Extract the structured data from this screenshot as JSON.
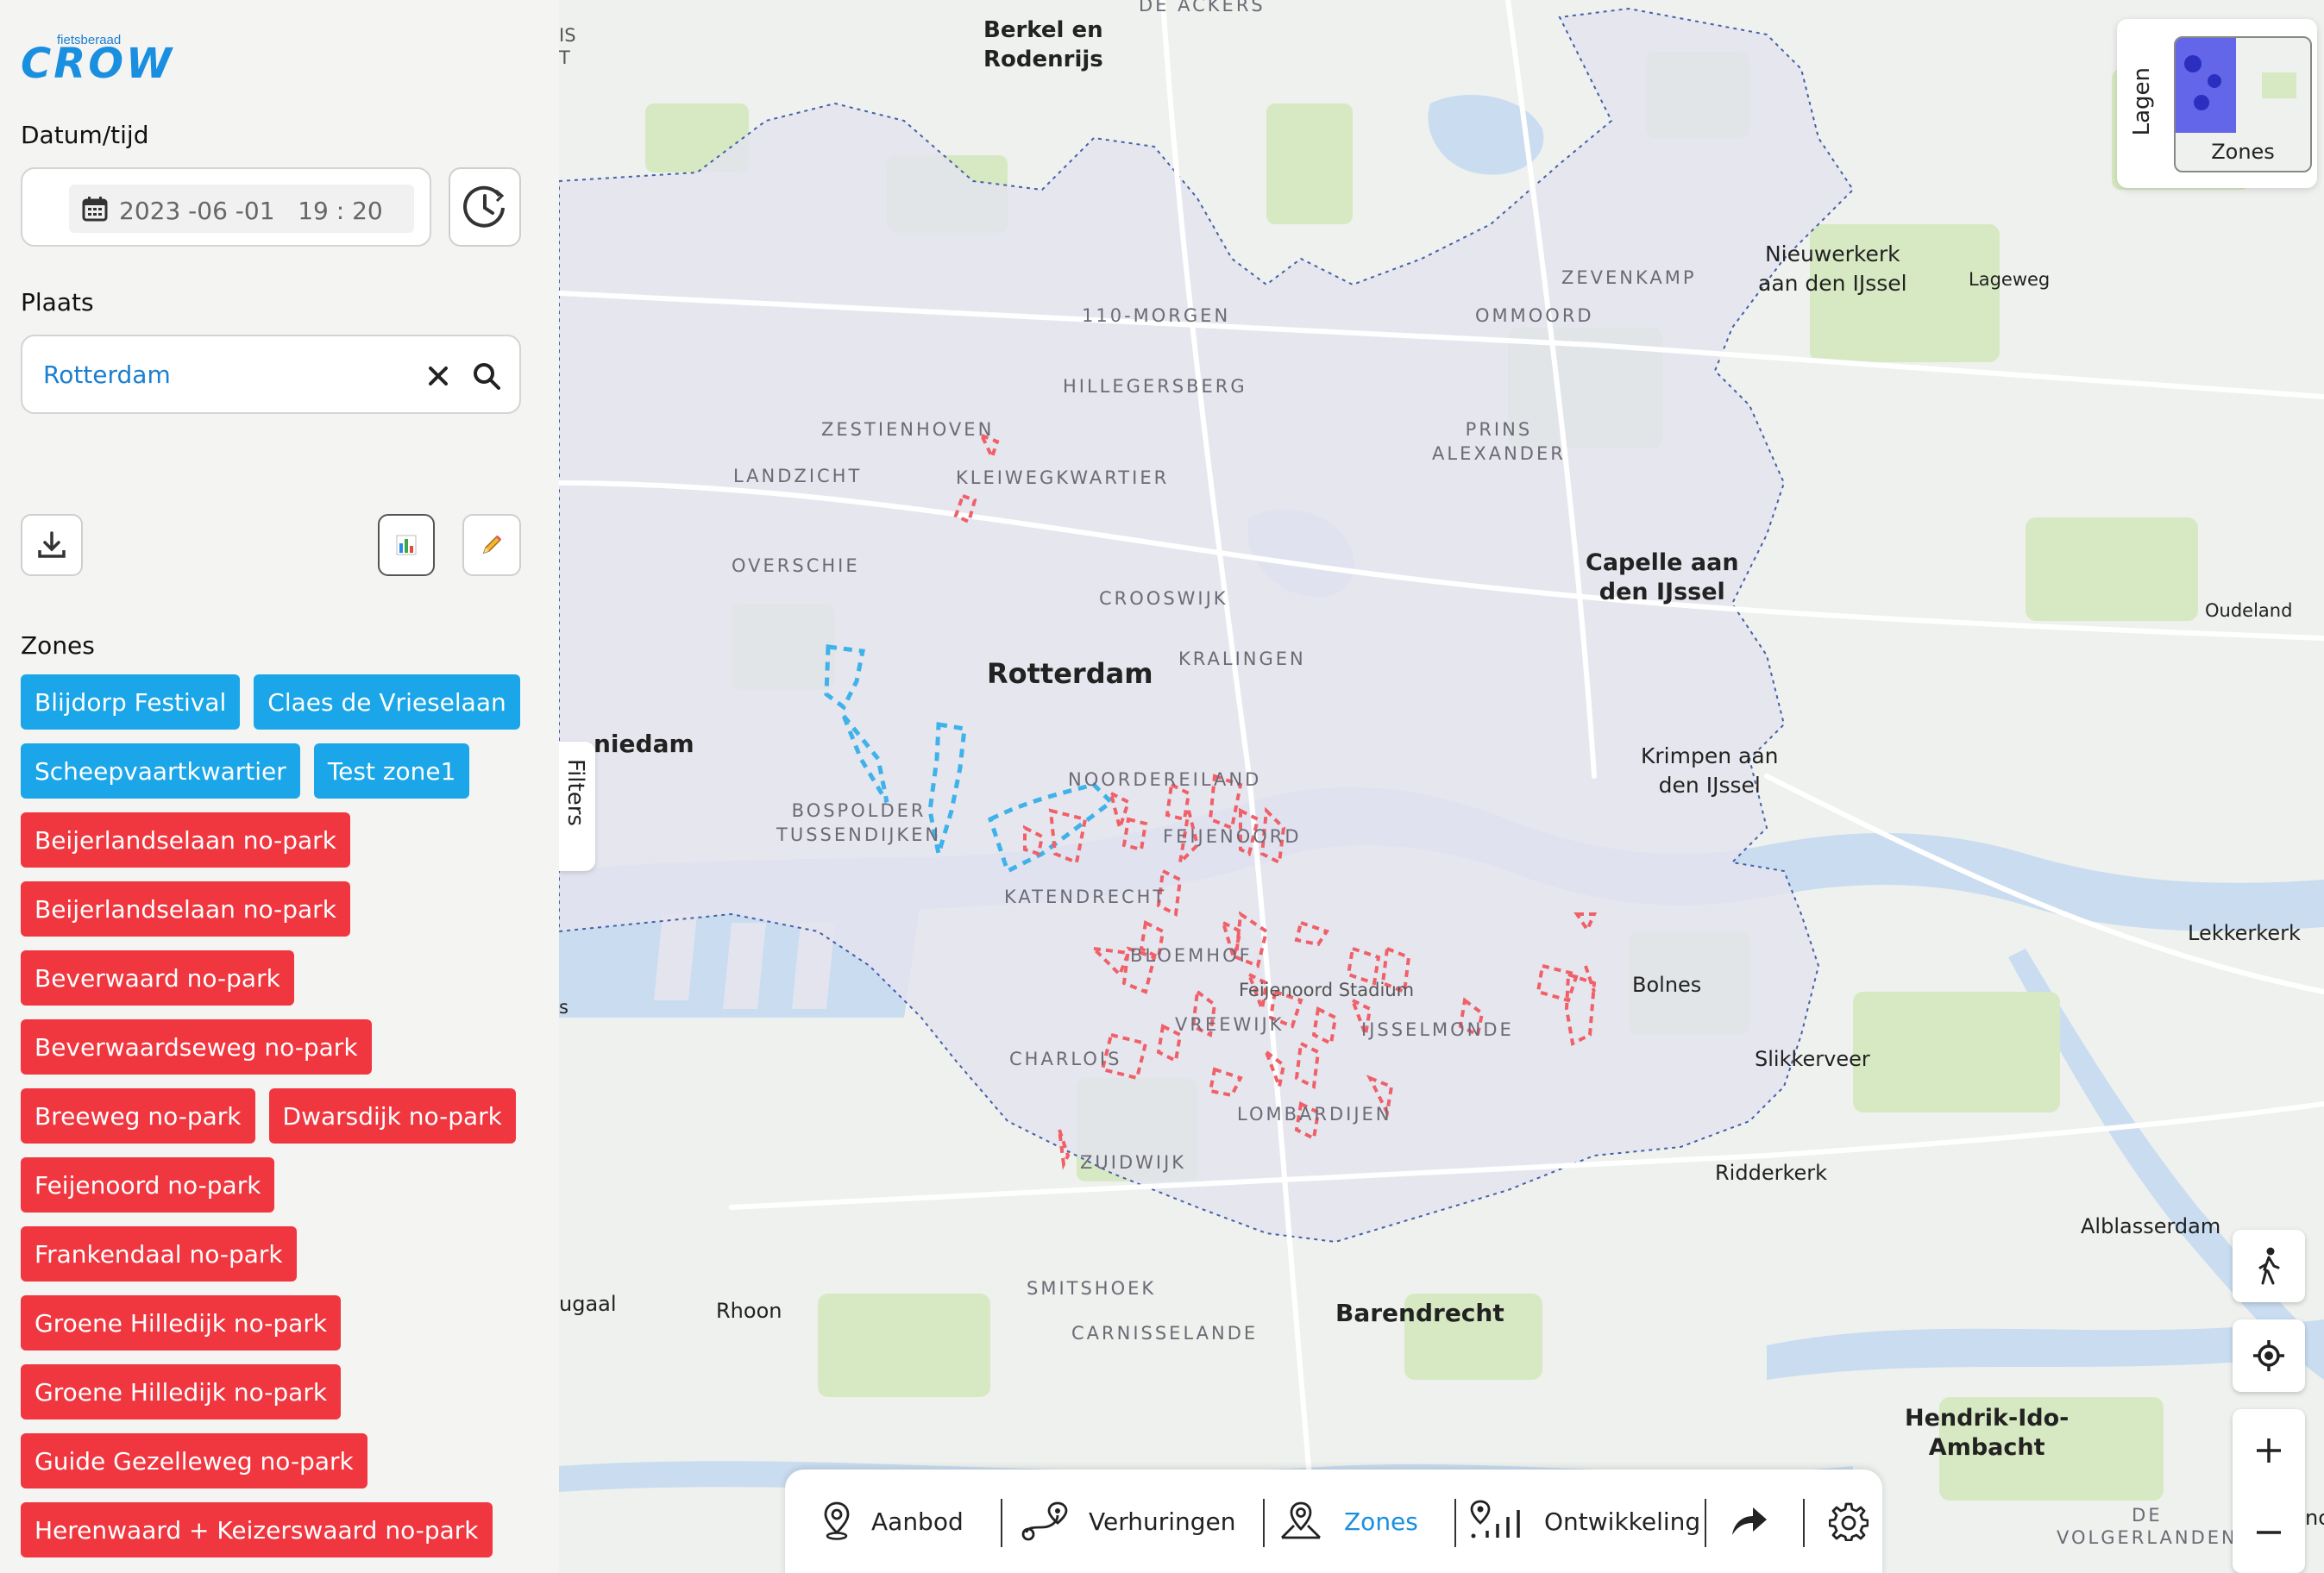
{
  "brand": {
    "small": "fietsberaad",
    "big": "CROW"
  },
  "sidebar": {
    "datetime_label": "Datum/tijd",
    "datetime_value": "2023 -06 -01   19 : 20",
    "place_label": "Plaats",
    "place_value": "Rotterdam",
    "zones_label": "Zones",
    "zones": [
      {
        "label": "Blijdorp Festival",
        "color": "blue"
      },
      {
        "label": "Claes de Vrieselaan",
        "color": "blue"
      },
      {
        "label": "Scheepvaartkwartier",
        "color": "blue"
      },
      {
        "label": "Test zone1",
        "color": "blue"
      },
      {
        "label": "Beijerlandselaan no-park",
        "color": "red"
      },
      {
        "label": "Beijerlandselaan no-park",
        "color": "red"
      },
      {
        "label": "Beverwaard no-park",
        "color": "red"
      },
      {
        "label": "Beverwaardseweg no-park",
        "color": "red"
      },
      {
        "label": "Breeweg no-park",
        "color": "red"
      },
      {
        "label": "Dwarsdijk no-park",
        "color": "red"
      },
      {
        "label": "Feijenoord no-park",
        "color": "red"
      },
      {
        "label": "Frankendaal no-park",
        "color": "red"
      },
      {
        "label": "Groene Hilledijk no-park",
        "color": "red"
      },
      {
        "label": "Groene Hilledijk no-park",
        "color": "red"
      },
      {
        "label": "Guide Gezelleweg no-park",
        "color": "red"
      },
      {
        "label": "Herenwaard + Keizerswaard no-park",
        "color": "red"
      }
    ]
  },
  "map": {
    "filters_tab": "Filters",
    "layers_label": "Lagen",
    "layer_thumb_label": "Zones",
    "labels": {
      "berkel": "Berkel en\nRodenrijs",
      "de_ackers": "DE ACKERS",
      "rotterdam": "Rotterdam",
      "capelle": "Capelle aan\nden IJssel",
      "nieuwerkerk": "Nieuwerkerk\naan den IJssel",
      "lageweg": "Lageweg",
      "oudeland": "Oudeland",
      "krimpen": "Krimpen aan\nden IJssel",
      "lekkerkerk": "Lekkerkerk",
      "bolnes": "Bolnes",
      "slikkerveer": "Slikkerveer",
      "ridderkerk": "Ridderkerk",
      "alblasserdam": "Alblasserdam",
      "barendrecht": "Barendrecht",
      "hendrik": "Hendrik-Ido-\nAmbacht",
      "rhoon": "Rhoon",
      "schiedam_partial": "niedam",
      "ugaal_partial": "ugaal",
      "is_partial": "IS\nT",
      "s_partial": "s",
      "nc_partial": "nc",
      "zevenkamp": "ZEVENKAMP",
      "ommoord": "OMMOORD",
      "morgen": "110-MORGEN",
      "hillegersberg": "HILLEGERSBERG",
      "prins": "PRINS\nALEXANDER",
      "zestienhoven": "ZESTIENHOVEN",
      "landzicht": "LANDZICHT",
      "kleiweg": "KLEIWEGKWARTIER",
      "overschie": "OVERSCHIE",
      "crooswijk": "CROOSWIJK",
      "kralingen": "KRALINGEN",
      "noordereiland": "NOORDEREILAND",
      "feijenoord": "FEIJENOORD",
      "bospolder": "BOSPOLDER\nTUSSENDIJKEN",
      "katendrecht": "KATENDRECHT",
      "bloemhof": "BLOEMHOF",
      "stadium": "Feijenoord Stadium",
      "vreewijk": "VREEWIJK",
      "ijsselmonde": "IJSSELMONDE",
      "charlois": "CHARLOIS",
      "lombardijen": "LOMBARDIJEN",
      "zuidwijk": "ZUIDWIJK",
      "smitshoek": "SMITSHOEK",
      "carnisselande": "CARNISSELANDE",
      "volgerlanden": "DE\nVOLGERLANDEN"
    }
  },
  "bottom_nav": {
    "items": [
      "Aanbod",
      "Verhuringen",
      "Zones",
      "Ontwikkeling"
    ],
    "active": "Zones"
  },
  "colors": {
    "accent": "#1a8fe0",
    "zone_blue": "#1aa6e8",
    "zone_red": "#f0363f",
    "city_fill": "#e4e4ef"
  }
}
